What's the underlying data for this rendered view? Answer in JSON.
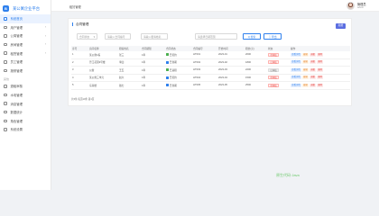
{
  "brand": {
    "logo": "B",
    "title": "某公寓企业平台"
  },
  "sidebar": {
    "items": [
      {
        "label": "系统首页",
        "icon": "home-icon",
        "active": true,
        "has_children": false
      },
      {
        "label": "用户管理",
        "icon": "user-icon",
        "active": false,
        "has_children": true
      },
      {
        "label": "公寓管理",
        "icon": "building-icon",
        "active": false,
        "has_children": true
      },
      {
        "label": "房间管理",
        "icon": "room-icon",
        "active": false,
        "has_children": true
      },
      {
        "label": "租赁管理",
        "icon": "contract-icon",
        "active": false,
        "has_children": true
      },
      {
        "label": "员工管理",
        "icon": "staff-icon",
        "active": false,
        "has_children": false
      },
      {
        "label": "报修管理",
        "icon": "repair-icon",
        "active": false,
        "has_children": false
      }
    ],
    "section_label": "其他",
    "items2": [
      {
        "label": "退租审核",
        "icon": "audit-icon"
      },
      {
        "label": "水电管理",
        "icon": "utility-icon"
      },
      {
        "label": "消息管理",
        "icon": "message-icon"
      },
      {
        "label": "数据统计",
        "icon": "stats-icon"
      },
      {
        "label": "角色管理",
        "icon": "role-icon"
      },
      {
        "label": "系统设置",
        "icon": "settings-icon"
      }
    ]
  },
  "header": {
    "breadcrumb": "租赁管理",
    "user_name": "管理员",
    "user_role": "admin"
  },
  "card": {
    "title": "合同管理",
    "add_label": "新增",
    "filters": {
      "select_value": "合同状态",
      "input_a": "请输入合同编号",
      "input_b": "请输入租客姓名",
      "input_c": "请选择日期范围",
      "search_label": "Q 搜索",
      "export_label": "⇩ 导出"
    }
  },
  "table": {
    "headers": [
      "序号",
      "房间名称",
      "租客姓名",
      "合同期限",
      "合同状态",
      "合同编号",
      "开始时间",
      "租金(元)",
      "状态",
      "操作"
    ],
    "rows": [
      {
        "no": "1",
        "room": "某公寓1栋",
        "tenant": "张三",
        "term": "1年",
        "status": "已签约",
        "status_color": "#4caf50",
        "code": "HT001",
        "start": "2023-01",
        "rent": "2000",
        "tag": "待审核",
        "tag_type": "red"
      },
      {
        "no": "2",
        "room": "芳江花园9号楼",
        "tenant": "李四",
        "term": "1年",
        "status": "已到期",
        "status_color": "#2f80ed",
        "code": "HT002",
        "start": "2023-02",
        "rent": "1800",
        "tag": "已审核",
        "tag_type": "red"
      },
      {
        "no": "3",
        "room": "公寓",
        "tenant": "王五",
        "term": "1年",
        "status": "已退租",
        "status_color": "#4caf50",
        "code": "HT003",
        "start": "2023-03",
        "rent": "2200",
        "tag": "已审核",
        "tag_type": "grey"
      },
      {
        "no": "4",
        "room": "某公寓三单元",
        "tenant": "赵六",
        "term": "1年",
        "status": "已签约",
        "status_color": "#2f80ed",
        "code": "HT004",
        "start": "2023-04",
        "rent": "1500",
        "tag": "待审核",
        "tag_type": "red"
      },
      {
        "no": "5",
        "room": "东南楼",
        "tenant": "钱七",
        "term": "1年",
        "status": "已到期",
        "status_color": "#2f80ed",
        "code": "HT005",
        "start": "2023-05",
        "rent": "2500",
        "tag": "待审核",
        "tag_type": "red"
      }
    ],
    "ops": [
      "查看详情",
      "编辑",
      "退租",
      "删除"
    ]
  },
  "pager": "共5条  每页10条  第1页",
  "watermark": "原生代码·Java",
  "colors": {
    "accent": "#2f80ed",
    "add_button": "#5b6ee1",
    "tag_red": "#e53935"
  }
}
